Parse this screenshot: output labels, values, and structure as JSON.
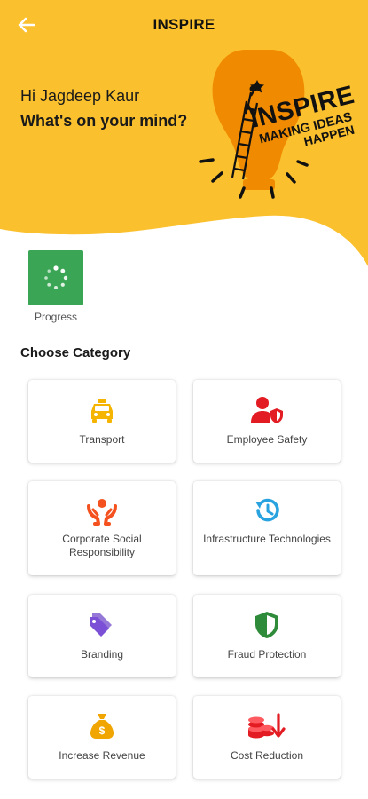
{
  "header": {
    "title": "INSPIRE",
    "back_icon": "arrow-left-icon"
  },
  "hero": {
    "greeting": "Hi Jagdeep Kaur",
    "question": "What's on your mind?",
    "logo": {
      "word": "INSPIRE",
      "tagline_1": "MAKING IDEAS",
      "tagline_2": "HAPPEN"
    }
  },
  "progress": {
    "label": "Progress",
    "icon": "loading-spinner-icon"
  },
  "categories": {
    "title": "Choose Category",
    "items": [
      {
        "label": "Transport",
        "icon": "taxi-icon"
      },
      {
        "label": "Employee Safety",
        "icon": "user-shield-icon"
      },
      {
        "label": "Corporate Social Responsibility",
        "icon": "hands-heart-icon"
      },
      {
        "label": "Infrastructure Technologies",
        "icon": "history-icon"
      },
      {
        "label": "Branding",
        "icon": "tags-icon"
      },
      {
        "label": "Fraud Protection",
        "icon": "shield-icon"
      },
      {
        "label": "Increase Revenue",
        "icon": "money-bag-icon"
      },
      {
        "label": "Cost Reduction",
        "icon": "coins-down-icon"
      }
    ]
  },
  "colors": {
    "brand_yellow": "#fbc02d",
    "progress_green": "#3aa655",
    "logo_orange": "#f08a00"
  }
}
